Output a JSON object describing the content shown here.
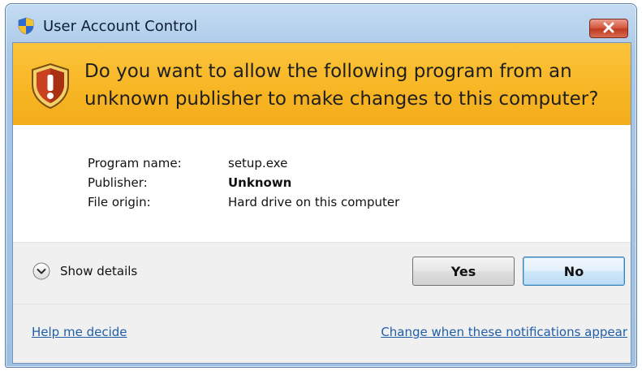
{
  "window": {
    "title": "User Account Control",
    "close_icon": "close-icon"
  },
  "banner": {
    "question": "Do you want to allow the following program from an unknown publisher to make changes to this computer?",
    "icon": "warning-shield-icon"
  },
  "details": {
    "rows": [
      {
        "label": "Program name:",
        "value": "setup.exe"
      },
      {
        "label": "Publisher:",
        "value": "Unknown"
      },
      {
        "label": "File origin:",
        "value": "Hard drive on this computer"
      }
    ]
  },
  "actions": {
    "show_details_label": "Show details",
    "yes_label": "Yes",
    "no_label": "No"
  },
  "links": {
    "help": "Help me decide",
    "change_notifications": "Change when these notifications appear"
  },
  "colors": {
    "banner": "#f7b523",
    "title_bar": "#a9c8e8",
    "close_button": "#d65a43",
    "link": "#1f5ea8"
  }
}
